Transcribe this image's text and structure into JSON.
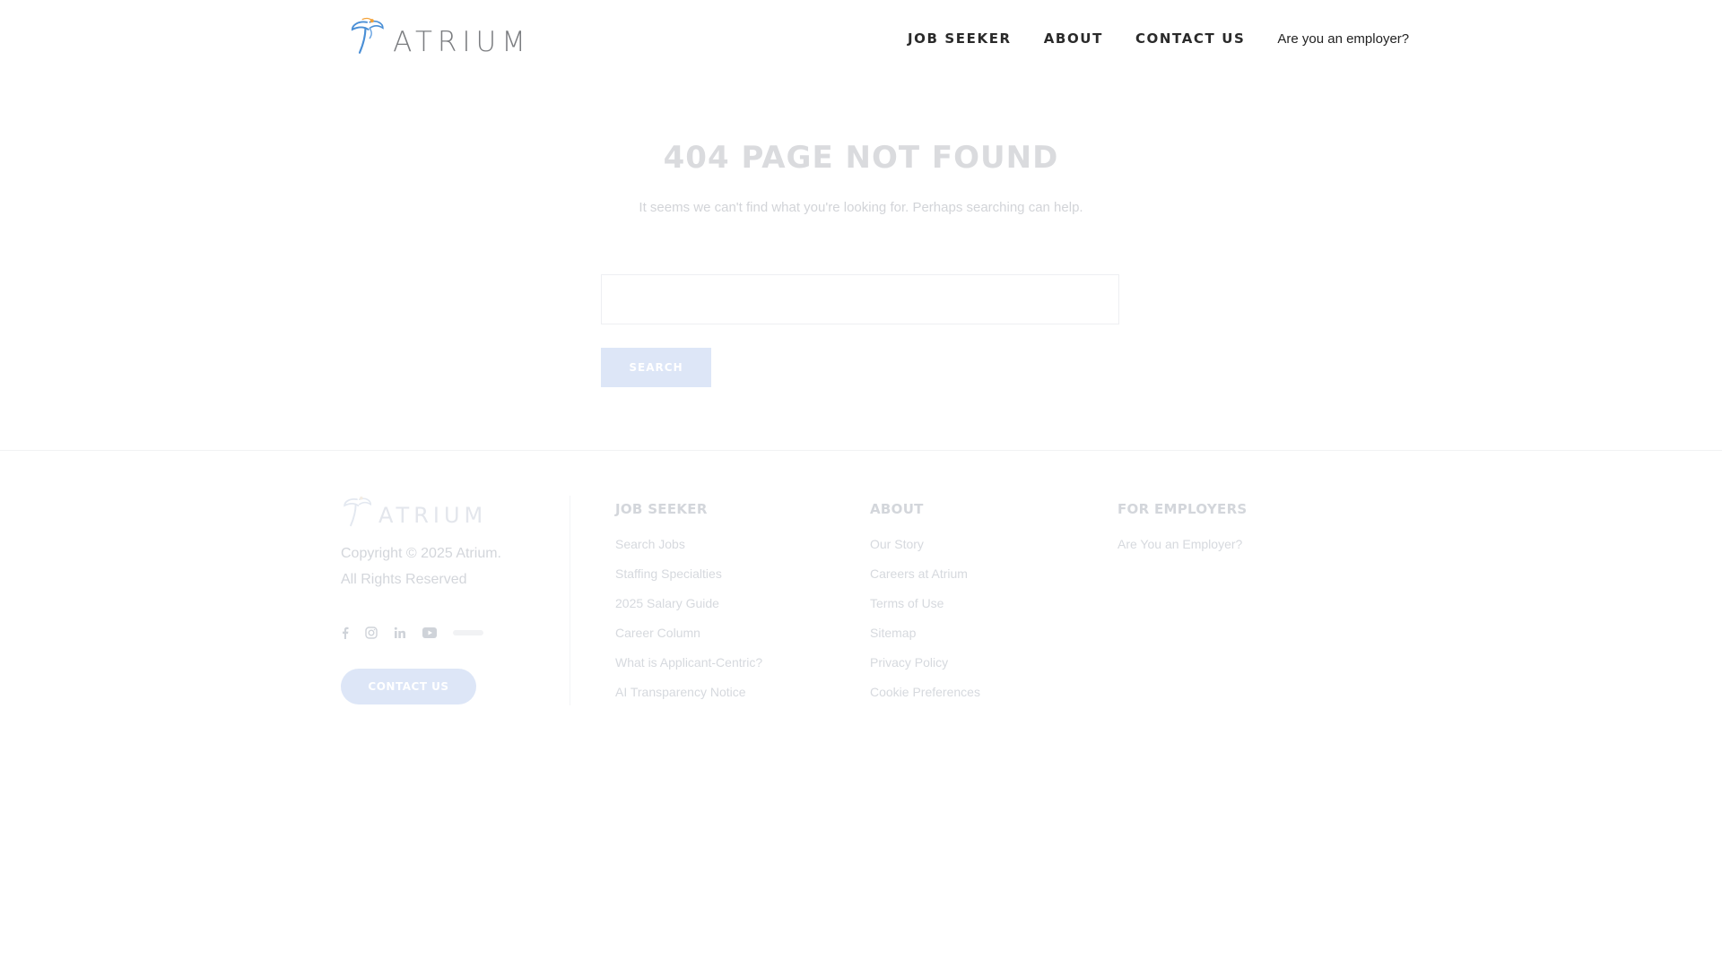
{
  "header": {
    "logo_text": "ATRIUM",
    "nav": [
      "JOB SEEKER",
      "ABOUT",
      "CONTACT US"
    ],
    "employer_link": "Are you an employer?"
  },
  "main": {
    "title": "404 PAGE NOT FOUND",
    "subtitle": "It seems we can't find what you're looking for. Perhaps searching can help.",
    "search_value": "",
    "search_button": "SEARCH"
  },
  "footer": {
    "logo_text": "ATRIUM",
    "copyright_line1": "Copyright © 2025 Atrium.",
    "copyright_line2": "All Rights Reserved",
    "social_icons": [
      "facebook-icon",
      "instagram-icon",
      "linkedin-icon",
      "youtube-icon",
      "extra-icon"
    ],
    "contact_button": "CONTACT US",
    "columns": [
      {
        "heading": "JOB SEEKER",
        "links": [
          "Search Jobs",
          "Staffing Specialties",
          "2025 Salary Guide",
          "Career Column",
          "What is Applicant-Centric?",
          "AI Transparency Notice"
        ]
      },
      {
        "heading": "ABOUT",
        "links": [
          "Our Story",
          "Careers at Atrium",
          "Terms of Use",
          "Sitemap",
          "Privacy Policy",
          "Cookie Preferences"
        ]
      },
      {
        "heading": "FOR EMPLOYERS",
        "links": [
          "Are You an Employer?"
        ]
      }
    ]
  },
  "colors": {
    "accent_blue": "#4a8fd6",
    "accent_orange": "#f3a23a",
    "button_bg": "#dde6f7",
    "logo_gray": "#7b7d80"
  }
}
